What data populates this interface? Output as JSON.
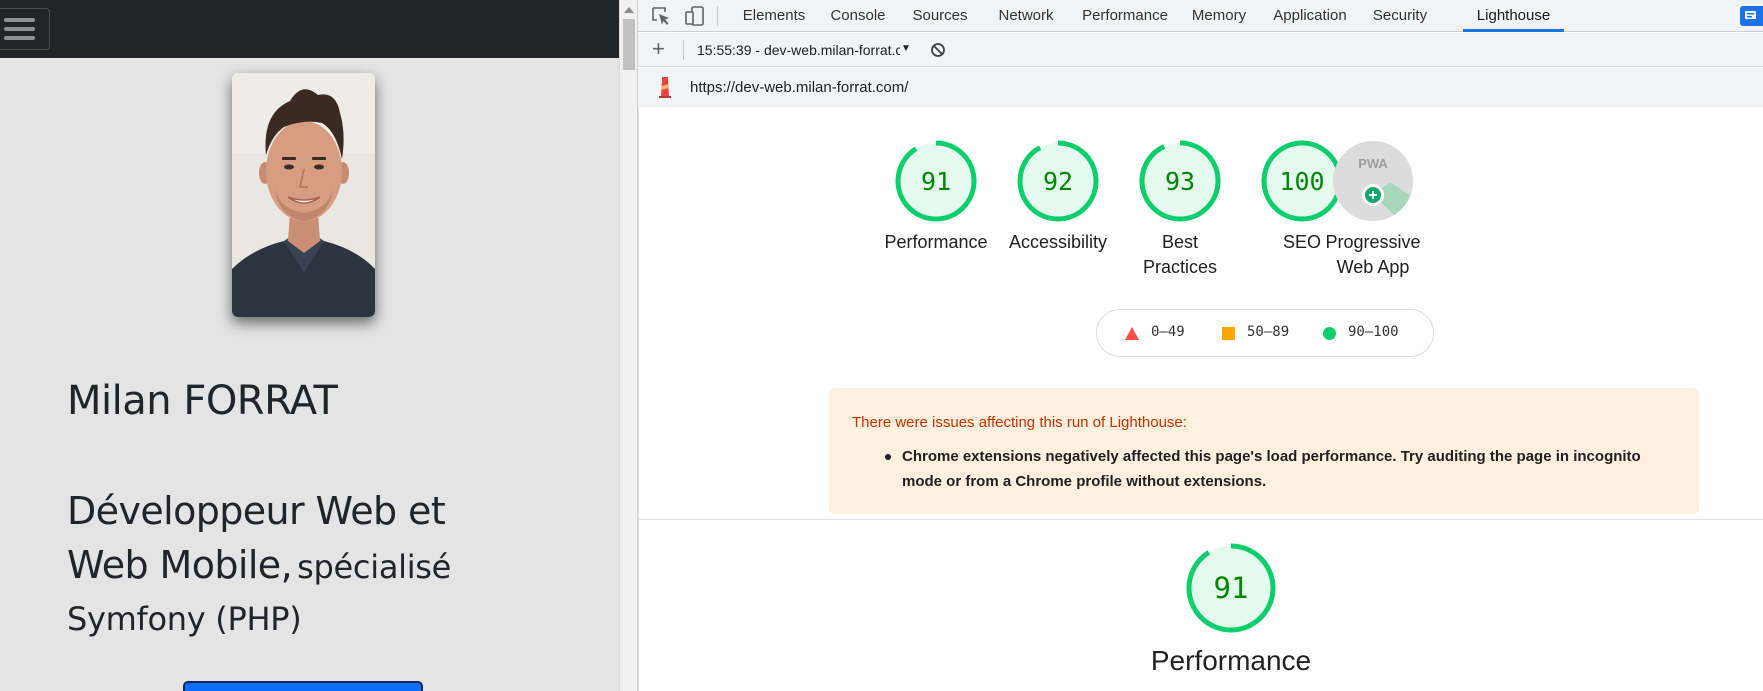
{
  "site": {
    "name": "Milan FORRAT",
    "role_main": "Développeur Web et Web Mobile,",
    "role_sub": "spécialisé Symfony (PHP)"
  },
  "devtools": {
    "tabs": [
      {
        "label": "Elements",
        "active": false
      },
      {
        "label": "Console",
        "active": false
      },
      {
        "label": "Sources",
        "active": false
      },
      {
        "label": "Network",
        "active": false
      },
      {
        "label": "Performance",
        "active": false
      },
      {
        "label": "Memory",
        "active": false
      },
      {
        "label": "Application",
        "active": false
      },
      {
        "label": "Security",
        "active": false
      },
      {
        "label": "Lighthouse",
        "active": true
      }
    ],
    "report_select": "15:55:39 - dev-web.milan-forrat.com",
    "url": "https://dev-web.milan-forrat.com/"
  },
  "lighthouse": {
    "scores": [
      {
        "score": 91,
        "label": "Performance"
      },
      {
        "score": 92,
        "label": "Accessibility"
      },
      {
        "score": 93,
        "label": "Best Practices"
      },
      {
        "score": 100,
        "label": "SEO"
      }
    ],
    "pwa": {
      "badge": "PWA",
      "label": "Progressive Web App"
    },
    "legend": [
      {
        "range": "0–49",
        "shape": "triangle",
        "color": "#ff4e42"
      },
      {
        "range": "50–89",
        "shape": "square",
        "color": "#ffa400"
      },
      {
        "range": "90–100",
        "shape": "circle",
        "color": "#0cce6b"
      }
    ],
    "warning": {
      "title": "There were issues affecting this run of Lighthouse:",
      "items": [
        "Chrome extensions negatively affected this page's load performance. Try auditing the page in incognito mode or from a Chrome profile without extensions."
      ]
    },
    "section": {
      "score": 91,
      "label": "Performance"
    },
    "colors": {
      "pass": "#0cce6b",
      "pass_text": "#008800",
      "pass_fill": "#e5faef"
    }
  }
}
